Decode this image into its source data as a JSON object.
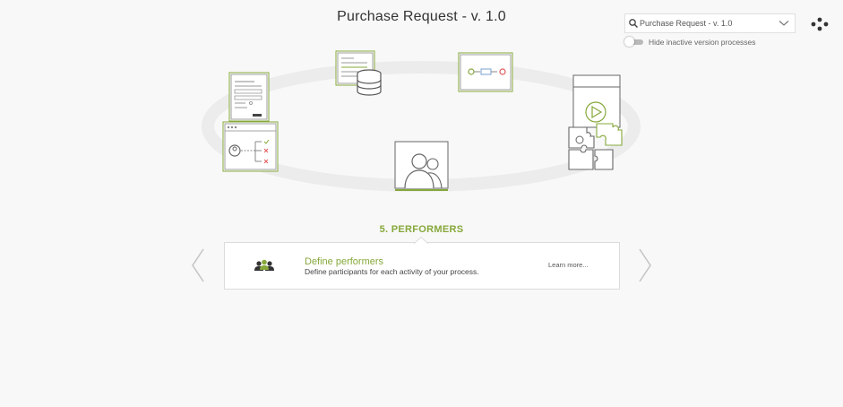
{
  "header": {
    "title": "Purchase Request - v. 1.0"
  },
  "process_select": {
    "selected": "Purchase Request - v. 1.0",
    "search_icon": "search-icon",
    "chevron_icon": "chevron-down-icon"
  },
  "toggle": {
    "label": "Hide inactive version processes",
    "checked": false
  },
  "menu": {
    "icon": "dots-menu-icon"
  },
  "steps": [
    {
      "name": "forms",
      "icon": "form-document-icon"
    },
    {
      "name": "data",
      "icon": "database-icon"
    },
    {
      "name": "flow",
      "icon": "process-flow-icon"
    },
    {
      "name": "execution",
      "icon": "play-window-icon"
    },
    {
      "name": "integrations",
      "icon": "puzzle-icon"
    },
    {
      "name": "rules",
      "icon": "user-rules-icon"
    },
    {
      "name": "performers",
      "icon": "performers-icon"
    }
  ],
  "section": {
    "heading": "5. PERFORMERS",
    "card_title": "Define performers",
    "card_description": "Define participants for each activity of your process.",
    "learn_more": "Learn more...",
    "card_icon": "group-users-icon"
  },
  "nav": {
    "prev_icon": "chevron-left-icon",
    "next_icon": "chevron-right-icon"
  },
  "colors": {
    "accent": "#86a83a",
    "background": "#f8f8f8",
    "red": "#e05a5a"
  }
}
